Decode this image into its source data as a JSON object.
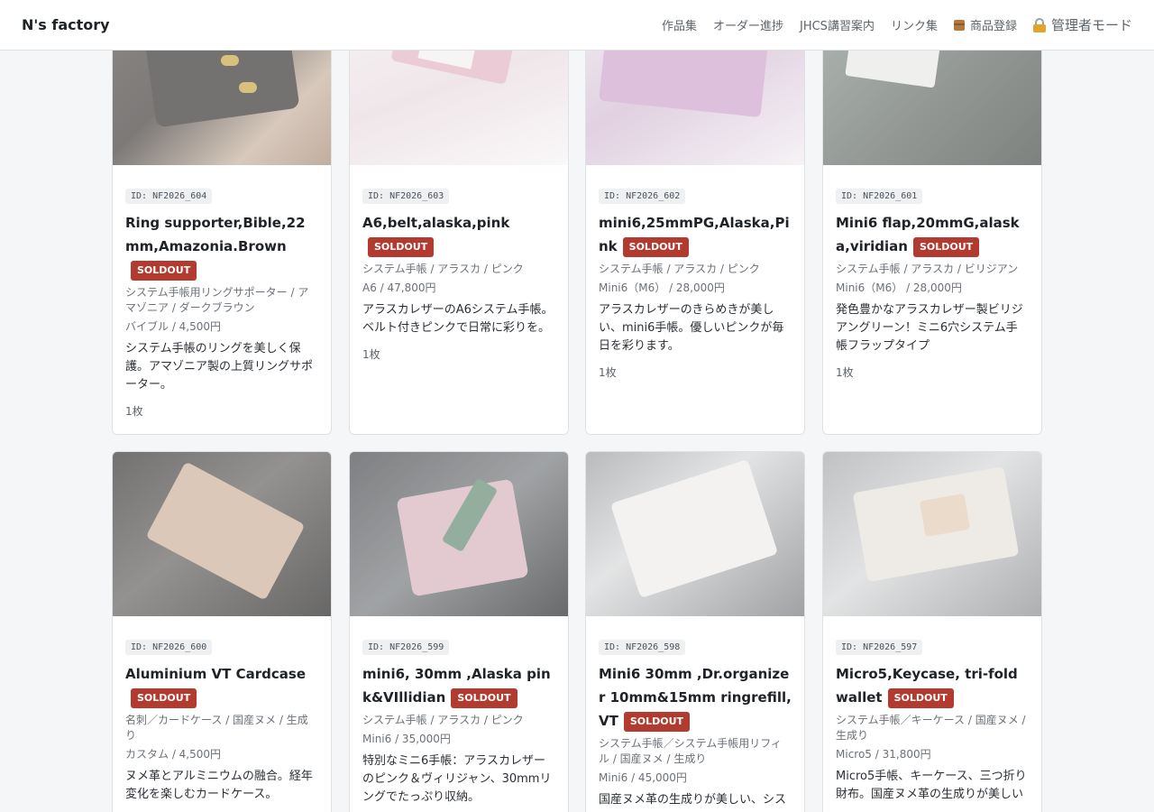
{
  "header": {
    "brand": "N's factory",
    "nav": [
      {
        "label": "作品集"
      },
      {
        "label": "オーダー進捗"
      },
      {
        "label": "JHCS講習案内"
      },
      {
        "label": "リンク集"
      },
      {
        "label": "商品登録",
        "icon": "package-icon"
      },
      {
        "label": "管理者モード",
        "icon": "lock-icon"
      }
    ]
  },
  "products": [
    {
      "id": "ID: NF2026_604",
      "title": "Ring supporter,Bible,22mm,Amazonia.Brown",
      "badge": "SOLDOUT",
      "category": "システム手帳用リングサポーター / アマゾニア / ダークブラウン",
      "price": "バイブル / 4,500円",
      "desc": "システム手帳のリングを美しく保護。アマゾニア製の上質リングサポーター。",
      "count": "1枚"
    },
    {
      "id": "ID: NF2026_603",
      "title": "A6,belt,alaska,pink",
      "badge": "SOLDOUT",
      "category": "システム手帳 / アラスカ / ピンク",
      "price": "A6 / 47,800円",
      "desc": "アラスカレザーのA6システム手帳。ベルト付きピンクで日常に彩りを。",
      "count": "1枚"
    },
    {
      "id": "ID: NF2026_602",
      "title": "mini6,25mmPG,Alaska,Pink",
      "badge": "SOLDOUT",
      "category": "システム手帳 / アラスカ / ピンク",
      "price": "Mini6（M6） / 28,000円",
      "desc": "アラスカレザーのきらめきが美しい、mini6手帳。優しいピンクが毎日を彩ります。",
      "count": "1枚"
    },
    {
      "id": "ID: NF2026_601",
      "title": "Mini6 flap,20mmG,alaska,viridian",
      "badge": "SOLDOUT",
      "category": "システム手帳 / アラスカ / ビリジアン",
      "price": "Mini6（M6） / 28,000円",
      "desc": "発色豊かなアラスカレザー製ビリジアングリーン！ミニ6穴システム手帳フラップタイプ",
      "count": "1枚"
    },
    {
      "id": "ID: NF2026_600",
      "title": "Aluminium VT Cardcase",
      "badge": "SOLDOUT",
      "category": "名刺／カードケース / 国産ヌメ / 生成り",
      "price": "カスタム / 4,500円",
      "desc": "ヌメ革とアルミニウムの融合。経年変化を楽しむカードケース。",
      "count": "1枚"
    },
    {
      "id": "ID: NF2026_599",
      "title": "mini6, 30mm ,Alaska pink&VIllidian",
      "badge": "SOLDOUT",
      "category": "システム手帳 / アラスカ / ピンク",
      "price": "Mini6 / 35,000円",
      "desc": "特別なミニ6手帳：アラスカレザーのピンク＆ヴィリジャン、30mmリングでたっぷり収納。",
      "count": ""
    },
    {
      "id": "ID: NF2026_598",
      "title": "Mini6 30mm ,Dr.organizer 10mm&15mm ringrefill, VT",
      "badge": "SOLDOUT",
      "category": "システム手帳／システム手帳用リフィル / 国産ヌメ / 生成り",
      "price": "Mini6 / 45,000円",
      "desc": "国産ヌメ革の生成りが美しい、シス",
      "count": ""
    },
    {
      "id": "ID: NF2026_597",
      "title": "Micro5,Keycase, tri-fold wallet",
      "badge": "SOLDOUT",
      "category": "システム手帳／キーケース / 国産ヌメ / 生成り",
      "price": "Micro5 / 31,800円",
      "desc": "Micro5手帳、キーケース、三つ折り財布。国産ヌメ革の生成りが美しい",
      "count": ""
    }
  ]
}
